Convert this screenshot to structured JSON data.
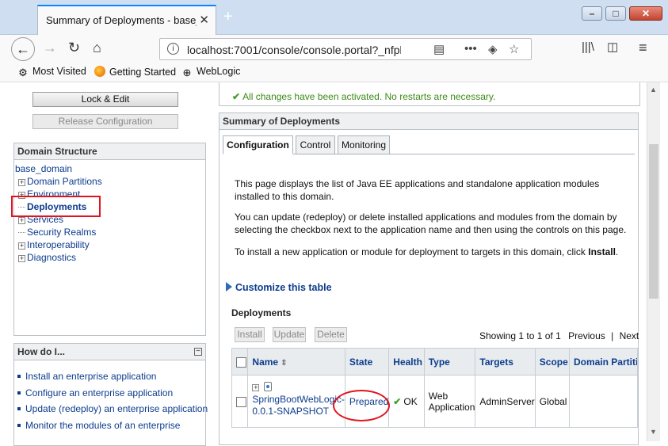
{
  "browser": {
    "tab_title": "Summary of Deployments - base_domain",
    "tab_close": "✕",
    "new_tab": "+",
    "url": "localhost:7001/console/console.portal?_nfpb",
    "window_controls": {
      "minimize": "–",
      "maximize": "□",
      "close": "✕"
    },
    "bookmarks": [
      {
        "label": "Most Visited",
        "icon": "gear-icon"
      },
      {
        "label": "Getting Started",
        "icon": "firefox-icon"
      },
      {
        "label": "WebLogic",
        "icon": "globe-icon"
      }
    ]
  },
  "change_center": {
    "lock_edit": "Lock & Edit",
    "release_config": "Release Configuration"
  },
  "domain_structure": {
    "title": "Domain Structure",
    "root": "base_domain",
    "items": [
      {
        "label": "Domain Partitions",
        "expandable": true
      },
      {
        "label": "Environment",
        "expandable": true
      },
      {
        "label": "Deployments",
        "expandable": false
      },
      {
        "label": "Services",
        "expandable": true
      },
      {
        "label": "Security Realms",
        "expandable": false
      },
      {
        "label": "Interoperability",
        "expandable": true
      },
      {
        "label": "Diagnostics",
        "expandable": true
      }
    ]
  },
  "how_do_i": {
    "title": "How do I...",
    "items": [
      "Install an enterprise application",
      "Configure an enterprise application",
      "Update (redeploy) an enterprise application",
      "Monitor the modules of an enterprise"
    ]
  },
  "message": "All changes have been activated. No restarts are necessary.",
  "main": {
    "title": "Summary of Deployments",
    "tabs": [
      "Configuration",
      "Control",
      "Monitoring"
    ],
    "para1": "This page displays the list of Java EE applications and standalone application modules installed to this domain.",
    "para2": "You can update (redeploy) or delete installed applications and modules from the domain by selecting the checkbox next to the application name and then using the controls on this page.",
    "para3_prefix": "To install a new application or module for deployment to targets in this domain, click ",
    "para3_bold": "Install",
    "para3_suffix": ".",
    "customize": "Customize this table",
    "deployments_title": "Deployments",
    "buttons": [
      "Install",
      "Update",
      "Delete"
    ],
    "paging": {
      "showing": "Showing 1 to 1 of 1",
      "previous": "Previous",
      "separator": "|",
      "next": "Next"
    },
    "columns": [
      "Name",
      "State",
      "Health",
      "Type",
      "Targets",
      "Scope",
      "Domain Partitions"
    ],
    "rows": [
      {
        "name_line1": "SpringBootWebLogic-",
        "name_line2": "0.0.1-SNAPSHOT",
        "state": "Prepared",
        "health": "OK",
        "type_line1": "Web",
        "type_line2": "Application",
        "targets": "AdminServer",
        "scope": "Global",
        "partitions": ""
      }
    ]
  }
}
